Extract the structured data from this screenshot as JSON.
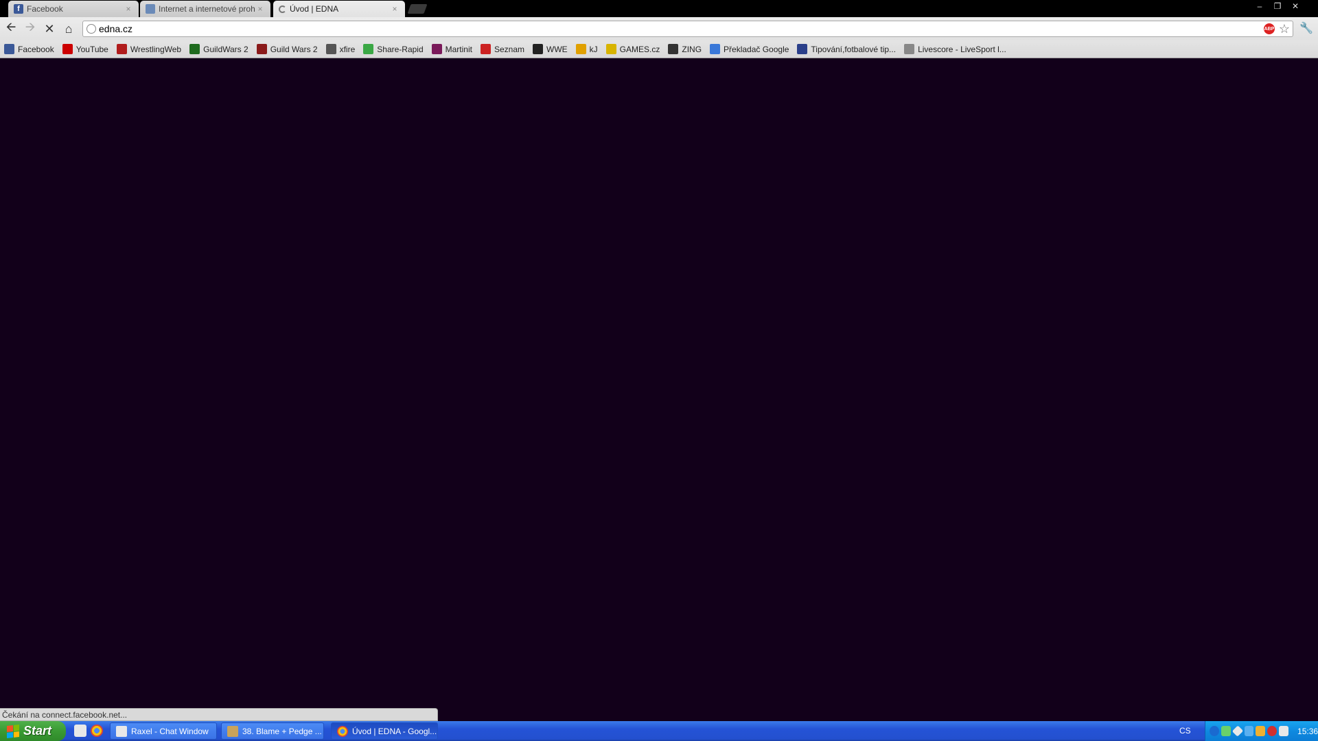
{
  "tabs": [
    {
      "title": "Facebook",
      "icon": "facebook-icon"
    },
    {
      "title": "Internet a internetové prohlíže",
      "icon": "page-icon"
    },
    {
      "title": "Úvod | EDNA",
      "icon": "loading-spinner-icon"
    }
  ],
  "toolbar": {
    "url": "edna.cz"
  },
  "bookmarks": [
    {
      "label": "Facebook",
      "icon": "facebook-icon",
      "color": "#3b5998"
    },
    {
      "label": "YouTube",
      "icon": "youtube-icon",
      "color": "#cc0000"
    },
    {
      "label": "WrestlingWeb",
      "icon": "wrestlingweb-icon",
      "color": "#b01c1c"
    },
    {
      "label": "GuildWars 2",
      "icon": "guildwars-icon",
      "color": "#1f6b1f"
    },
    {
      "label": "Guild Wars 2",
      "icon": "guildwars2-icon",
      "color": "#8a1a1a"
    },
    {
      "label": "xfire",
      "icon": "xfire-icon",
      "color": "#555555"
    },
    {
      "label": "Share-Rapid",
      "icon": "share-rapid-icon",
      "color": "#3aa845"
    },
    {
      "label": "Martinit",
      "icon": "martinit-icon",
      "color": "#7a1a5a"
    },
    {
      "label": "Seznam",
      "icon": "seznam-icon",
      "color": "#cc2222"
    },
    {
      "label": "WWE",
      "icon": "wwe-icon",
      "color": "#222222"
    },
    {
      "label": "kJ",
      "icon": "kj-icon",
      "color": "#e0a000"
    },
    {
      "label": "GAMES.cz",
      "icon": "games-cz-icon",
      "color": "#d8b400"
    },
    {
      "label": "ZING",
      "icon": "zing-icon",
      "color": "#333333"
    },
    {
      "label": "Překladač Google",
      "icon": "google-translate-icon",
      "color": "#3a78d8"
    },
    {
      "label": "Tipování,fotbalové tip...",
      "icon": "tipovani-icon",
      "color": "#2a3f8a"
    },
    {
      "label": "Livescore - LiveSport l...",
      "icon": "livescore-icon",
      "color": "#888888"
    }
  ],
  "status": {
    "text": "Čekání na connect.facebook.net..."
  },
  "taskbar": {
    "start_label": "Start",
    "items": [
      {
        "label": "Raxel - Chat Window",
        "icon": "xfire-chat-icon"
      },
      {
        "label": "38. Blame + Pedge   ...",
        "icon": "media-player-icon"
      },
      {
        "label": "Úvod | EDNA - Googl...",
        "icon": "chrome-icon"
      }
    ],
    "language": "CS",
    "clock": "15:36"
  }
}
